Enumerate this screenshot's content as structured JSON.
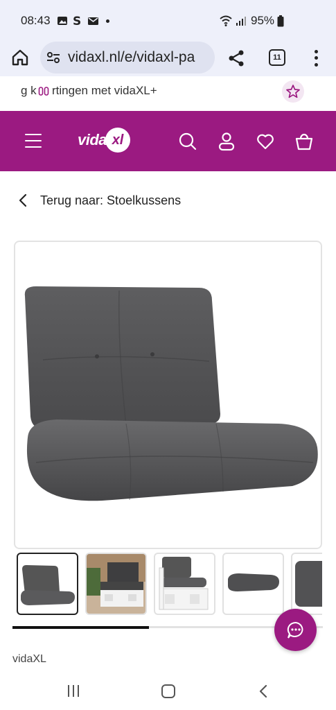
{
  "status_bar": {
    "time": "08:43",
    "left_icons": [
      "gallery-icon",
      "s-app-icon",
      "mail-icon",
      "dot-icon"
    ],
    "battery_percent": "95%",
    "right_icons": [
      "wifi-icon",
      "signal-icon",
      "battery-icon"
    ]
  },
  "browser": {
    "url": "vidaxl.nl/e/vidaxl-pa",
    "tab_count": "11"
  },
  "promo": {
    "text_before": "g k",
    "text_after": "rtingen met vidaXL+"
  },
  "header": {
    "logo_text": "vida",
    "logo_badge": "xl",
    "brand_color": "#9b1a81"
  },
  "breadcrumb": {
    "label": "Terug naar: Stoelkussens"
  },
  "gallery": {
    "thumb_count": 5,
    "active_index": 0,
    "scroll_progress": 0.44
  },
  "product": {
    "brand": "vidaXL"
  }
}
